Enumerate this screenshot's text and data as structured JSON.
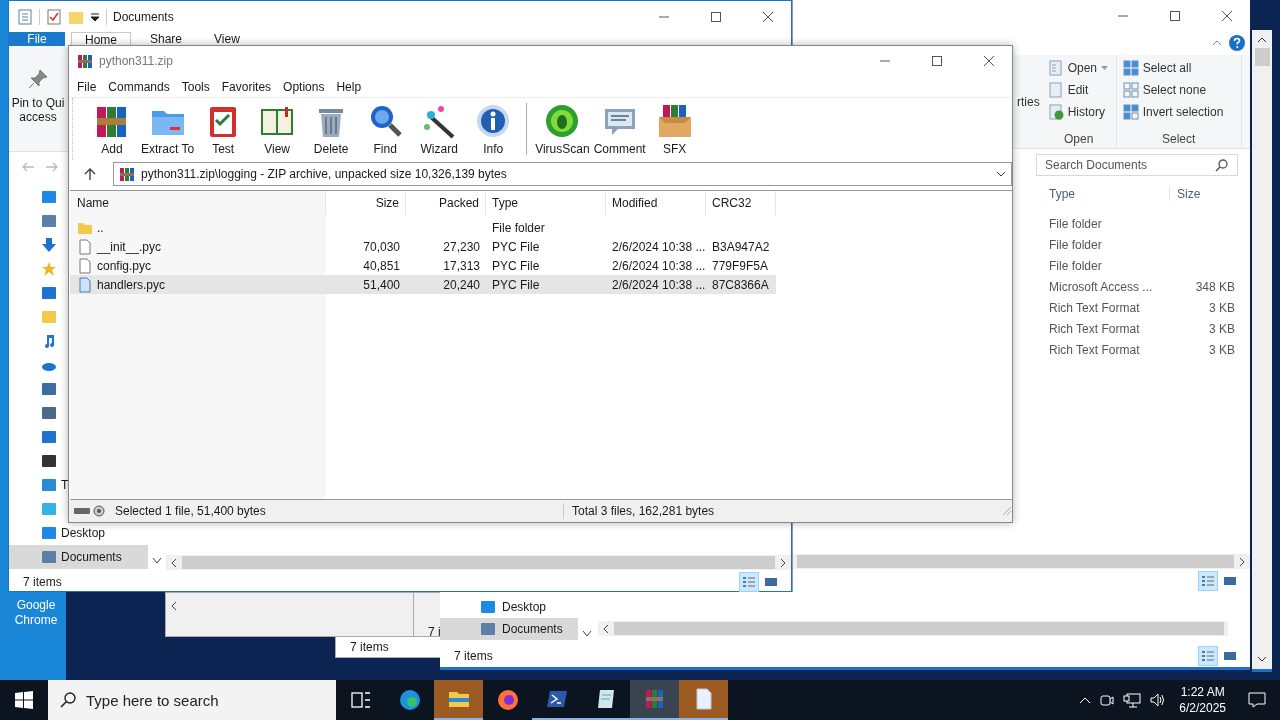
{
  "desktop": {
    "icons": [
      {
        "label": "Google Chrome"
      }
    ]
  },
  "explorer_main": {
    "title": "Documents",
    "ribbon_tabs": [
      {
        "label": "File",
        "kind": "file",
        "selected": false
      },
      {
        "label": "Home",
        "kind": "tab",
        "selected": true
      },
      {
        "label": "Share",
        "kind": "tab",
        "selected": false
      },
      {
        "label": "View",
        "kind": "tab",
        "selected": false
      }
    ],
    "pin_label": "Pin to Qui access",
    "nav_items": [
      {
        "kind": "desktop",
        "selected": false
      },
      {
        "kind": "document",
        "selected": false
      },
      {
        "kind": "download",
        "selected": false
      },
      {
        "kind": "star",
        "selected": false
      },
      {
        "kind": "share",
        "selected": false
      },
      {
        "kind": "folder",
        "selected": false
      },
      {
        "kind": "music",
        "selected": false
      },
      {
        "kind": "cloud",
        "selected": false
      },
      {
        "kind": "window",
        "selected": false
      },
      {
        "kind": "tools",
        "selected": false
      },
      {
        "kind": "search",
        "selected": false
      },
      {
        "kind": "film",
        "selected": false
      },
      {
        "kind": "pc",
        "label": "T",
        "selected": false
      },
      {
        "kind": "cube",
        "selected": false
      },
      {
        "kind": "desktop",
        "label": "Desktop",
        "selected": false
      },
      {
        "kind": "document",
        "label": "Documents",
        "selected": true
      }
    ],
    "status": "7 items",
    "view_buttons": [
      {
        "kind": "details",
        "selected": true
      },
      {
        "kind": "tiles",
        "selected": false
      }
    ]
  },
  "explorer_right": {
    "ribbon_fragment": "rties",
    "open_group": {
      "label": "Open",
      "items": [
        {
          "label": "Open",
          "kind": "open",
          "has_menu": true
        },
        {
          "label": "Edit",
          "kind": "edit",
          "has_menu": false
        },
        {
          "label": "History",
          "kind": "history",
          "has_menu": false
        }
      ]
    },
    "select_group": {
      "label": "Select",
      "items": [
        {
          "label": "Select all",
          "kind": "all"
        },
        {
          "label": "Select none",
          "kind": "none"
        },
        {
          "label": "Invert selection",
          "kind": "invert"
        }
      ]
    },
    "search": {
      "placeholder": "Search Documents"
    },
    "columns": [
      "Type",
      "Size"
    ],
    "rows": [
      {
        "type": "File folder"
      },
      {
        "type": "File folder"
      },
      {
        "type": "File folder"
      },
      {
        "type": "Microsoft Access ...",
        "size": "348 KB"
      },
      {
        "type": "Rich Text Format",
        "size": "3 KB"
      },
      {
        "type": "Rich Text Format",
        "size": "3 KB"
      },
      {
        "type": "Rich Text Format",
        "size": "3 KB"
      }
    ],
    "view_buttons": [
      {
        "kind": "details",
        "selected": true
      },
      {
        "kind": "tiles",
        "selected": false
      }
    ]
  },
  "lower_window": {
    "nav_items": [
      {
        "kind": "desktop",
        "label": "Desktop",
        "selected": false
      },
      {
        "kind": "document",
        "label": "Documents",
        "selected": true
      }
    ],
    "status": "7 items",
    "view_buttons": [
      {
        "kind": "details",
        "selected": true
      },
      {
        "kind": "tiles",
        "selected": false
      }
    ]
  },
  "back_windows": [
    {
      "status": "7 items"
    },
    {
      "status": "7 i"
    }
  ],
  "winrar": {
    "title": "python311.zip",
    "menu": [
      "File",
      "Commands",
      "Tools",
      "Favorites",
      "Options",
      "Help"
    ],
    "toolbar": [
      {
        "label": "Add",
        "kind": "add"
      },
      {
        "label": "Extract To",
        "kind": "extract"
      },
      {
        "label": "Test",
        "kind": "test"
      },
      {
        "label": "View",
        "kind": "view"
      },
      {
        "label": "Delete",
        "kind": "delete"
      },
      {
        "label": "Find",
        "kind": "find"
      },
      {
        "label": "Wizard",
        "kind": "wizard"
      },
      {
        "label": "Info",
        "kind": "info"
      },
      {
        "label": "VirusScan",
        "kind": "virus"
      },
      {
        "label": "Comment",
        "kind": "comment"
      },
      {
        "label": "SFX",
        "kind": "sfx"
      }
    ],
    "address": "python311.zip\\logging - ZIP archive, unpacked size 10,326,139 bytes",
    "columns": [
      "Name",
      "Size",
      "Packed",
      "Type",
      "Modified",
      "CRC32"
    ],
    "rows": [
      {
        "kind": "folder",
        "name": "..",
        "type": "File folder",
        "selected": false
      },
      {
        "kind": "file",
        "name": "__init__.pyc",
        "size": "70,030",
        "packed": "27,230",
        "type": "PYC File",
        "modified": "2/6/2024 10:38 ...",
        "crc": "B3A947A2",
        "selected": false
      },
      {
        "kind": "file",
        "name": "config.pyc",
        "size": "40,851",
        "packed": "17,313",
        "type": "PYC File",
        "modified": "2/6/2024 10:38 ...",
        "crc": "779F9F5A",
        "selected": false
      },
      {
        "kind": "file",
        "name": "handlers.pyc",
        "size": "51,400",
        "packed": "20,240",
        "type": "PYC File",
        "modified": "2/6/2024 10:38 ...",
        "crc": "87C8366A",
        "selected": true
      }
    ],
    "status_left": "Selected 1 file, 51,400 bytes",
    "status_right": "Total 3 files, 162,281 bytes"
  },
  "taskbar": {
    "search_placeholder": "Type here to search",
    "apps": [
      {
        "kind": "taskview",
        "running": false,
        "active": false,
        "flashing": false
      },
      {
        "kind": "edge",
        "running": false,
        "active": false,
        "flashing": false
      },
      {
        "kind": "explorer",
        "running": true,
        "active": false,
        "flashing": true
      },
      {
        "kind": "firefox",
        "running": false,
        "active": false,
        "flashing": false
      },
      {
        "kind": "powershell",
        "running": true,
        "active": false,
        "flashing": false
      },
      {
        "kind": "notepad",
        "running": true,
        "active": false,
        "flashing": false
      },
      {
        "kind": "winrar",
        "running": true,
        "active": true,
        "flashing": false
      },
      {
        "kind": "file",
        "running": true,
        "active": false,
        "flashing": true
      }
    ],
    "time": "1:22 AM",
    "date": "6/2/2025"
  }
}
